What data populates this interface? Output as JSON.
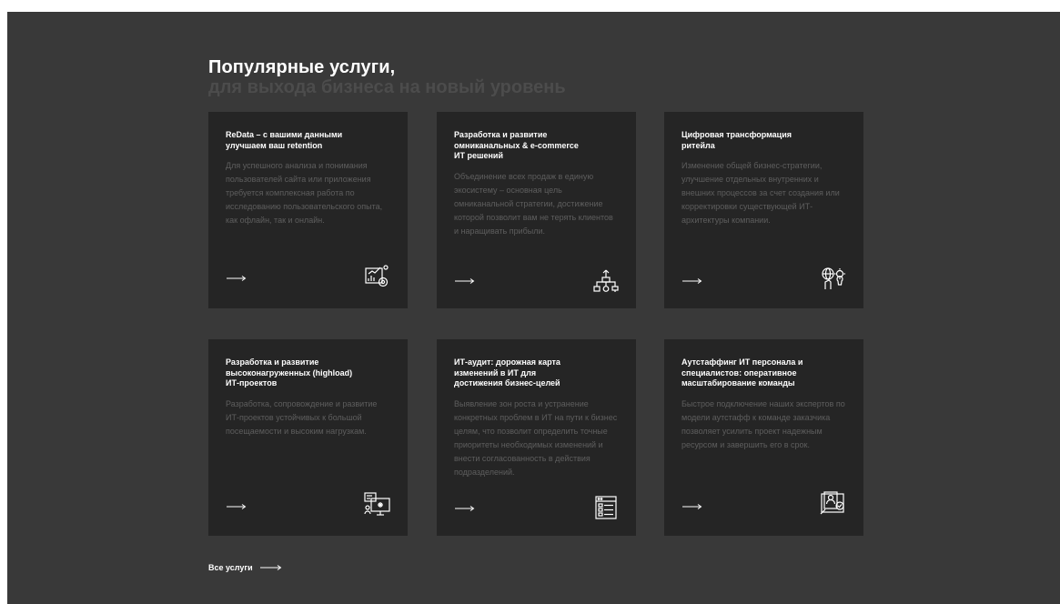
{
  "section": {
    "title": "Популярные услуги,",
    "subtitle": "для выхода бизнеса на новый уровень"
  },
  "cards": [
    {
      "title": "ReData – с вашими данными\nулучшаем ваш retention",
      "description": "Для успешного анализа и понимания пользователей сайта или приложения требуется комплексная работа по исследованию пользовательского опыта, как офлайн, так и онлайн.",
      "icon": "analytics-dashboard-icon"
    },
    {
      "title": "Разработка и развитие\nомниканальных & e-commerce\nИТ решений",
      "description": "Объединение всех продаж в единую экосистему – основная цель омниканальной стратегии, достижение которой позволит вам не терять клиентов и наращивать прибыли.",
      "icon": "omnichannel-network-icon"
    },
    {
      "title": "Цифровая трансформация\nритейла",
      "description": "Изменение общей бизнес-стратегии, улучшение отдельных внутренних и внешних процессов за счет создания или корректировки существующей ИТ-архитектуры компании.",
      "icon": "digital-transformation-icon"
    },
    {
      "title": "Разработка и развитие\nвысоконагруженных (highload)\nИТ-проектов",
      "description": "Разработка, сопровождение и развитие ИТ-проектов устойчивых к большой посещаемости и высоким нагрузкам.",
      "icon": "highload-monitor-icon"
    },
    {
      "title": "ИТ-аудит: дорожная карта\nизменений в ИТ для\nдостижения бизнес-целей",
      "description": "Выявление зон роста и устранение конкретных проблем в ИТ на пути к бизнес целям, что позволит определить точные приоритеты необходимых изменений и внести согласованность в действия подразделений.",
      "icon": "audit-checklist-icon"
    },
    {
      "title": "Аутстаффинг ИТ персонала и\nспециалистов: оперативное\nмасштабирование команды",
      "description": "Быстрое подключение наших экспертов по модели аутстафф к команде заказчика позволяет усилить проект надежным ресурсом и завершить его в срок.",
      "icon": "outstaffing-profile-icon"
    }
  ],
  "footer_link": {
    "label": "Все услуги"
  }
}
